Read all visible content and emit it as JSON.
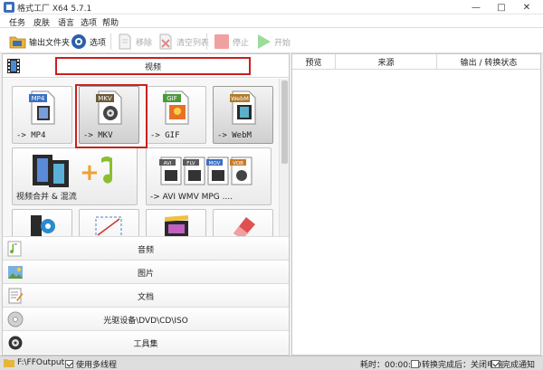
{
  "window": {
    "title": "格式工厂 X64 5.7.1"
  },
  "menu": [
    "任务",
    "皮肤",
    "语言",
    "选项",
    "帮助"
  ],
  "toolbar": {
    "output_folder": "输出文件夹",
    "options": "选项",
    "remove": "移除",
    "clear_list": "清空列表",
    "stop": "停止",
    "start": "开始"
  },
  "left": {
    "video_header": "视频",
    "tiles": [
      {
        "label": "-> MP4",
        "badge": "MP4",
        "badge_color": "#3d6fc2"
      },
      {
        "label": "-> MKV",
        "badge": "MKV",
        "badge_color": "#6b5a3a"
      },
      {
        "label": "-> GIF",
        "badge": "GIF",
        "badge_color": "#4a9a3a"
      },
      {
        "label": "-> WebM",
        "badge": "WebM",
        "badge_color": "#b07a2a"
      },
      {
        "label": "视频合并 & 混流"
      },
      {
        "label": "-> AVI WMV MPG ....",
        "badges": [
          "AVI",
          "FLV",
          "MOV",
          "VOB"
        ]
      }
    ],
    "categories": [
      "音频",
      "图片",
      "文档",
      "光驱设备\\DVD\\CD\\ISO",
      "工具集"
    ]
  },
  "right": {
    "columns": [
      "预览",
      "来源",
      "输出 / 转换状态"
    ]
  },
  "status": {
    "output_path": "F:\\FFOutput",
    "multithread": "使用多线程",
    "elapsed": "耗时：00:00:00",
    "after_convert": "转换完成后：关闭电脑",
    "notify": "完成通知"
  },
  "colors": {
    "highlight_red": "#cc1f1f",
    "start_green": "#39b54a",
    "stop_red": "#e45a5a"
  }
}
